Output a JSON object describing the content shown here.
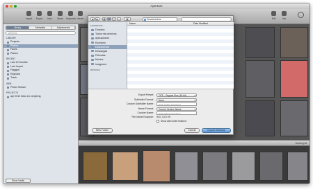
{
  "window": {
    "title": "Aperture"
  },
  "toolbar": {
    "items": [
      {
        "label": "Import",
        "icon": "import-icon"
      },
      {
        "label": "Export",
        "icon": "export-icon"
      },
      {
        "label": "New",
        "icon": "new-icon"
      },
      {
        "label": "Share",
        "icon": "share-icon"
      },
      {
        "label": "Keywords",
        "icon": "keywords-icon"
      },
      {
        "label": "Viewer",
        "icon": "viewer-icon"
      }
    ],
    "right_items": [
      {
        "label": "Edit",
        "icon": "edit-icon"
      },
      {
        "label": "Info",
        "icon": "info-icon"
      }
    ]
  },
  "sidebar": {
    "tabs": [
      "Library",
      "Metadata",
      "Adjustments"
    ],
    "active_tab": "Library",
    "search_placeholder": "All Items",
    "sections": [
      {
        "heading": "LIBRARY",
        "items": [
          "Projects",
          "Photos",
          "Faces",
          "Places"
        ]
      },
      {
        "heading": "RECENT",
        "items": [
          "Last 12 Months",
          "Last Import",
          "Flagged",
          "Rejected",
          "Trash"
        ]
      },
      {
        "heading": "WEB",
        "items": [
          "Photo Stream"
        ]
      },
      {
        "heading": "PROJECTS",
        "items": [
          "apr 2012 fotos en zenjering"
        ]
      }
    ],
    "selected_item": "Photos",
    "bottom_button": "Show Vaults"
  },
  "dialog": {
    "location": "Documentos",
    "favorites_heading": "FAVORITOS",
    "favorites": [
      {
        "label": "Dropbox",
        "icon": "dropbox-icon"
      },
      {
        "label": "Todos mis archivos",
        "icon": "all-files-icon"
      },
      {
        "label": "Aplicaciones",
        "icon": "applications-icon"
      },
      {
        "label": "Escritorio",
        "icon": "desktop-icon"
      },
      {
        "label": "Documentos",
        "icon": "documents-icon"
      },
      {
        "label": "Descargas",
        "icon": "downloads-icon"
      },
      {
        "label": "Películas",
        "icon": "movies-icon"
      },
      {
        "label": "Música",
        "icon": "music-icon"
      },
      {
        "label": "Imágenes",
        "icon": "pictures-icon"
      }
    ],
    "selected_favorite": "Documentos",
    "devices_heading": "DEVICES",
    "columns": {
      "name": "Name",
      "date": "Date Modified"
    },
    "options": {
      "export_preset_label": "Export Preset:",
      "export_preset_value": "TIFF - Original Size (16-bit)",
      "subfolder_format_label": "Subfolder Format:",
      "subfolder_format_value": "None",
      "custom_subfolder_label": "Custom Subfolder Name:",
      "custom_subfolder_placeholder": "Enter Folder and Name",
      "name_format_label": "Name Format:",
      "name_format_value": "Current Version Name",
      "custom_name_label": "Custom Name:",
      "custom_name_placeholder": "Enter Name and Name",
      "file_example_label": "File Name Example:",
      "file_example_value": "IMG_0327.tiff",
      "show_alert_label": "Show alert when finished"
    },
    "buttons": {
      "new_folder": "New Folder",
      "cancel": "Cancel",
      "export": "Export Versions"
    }
  },
  "browser": {
    "status": "Showing All"
  }
}
